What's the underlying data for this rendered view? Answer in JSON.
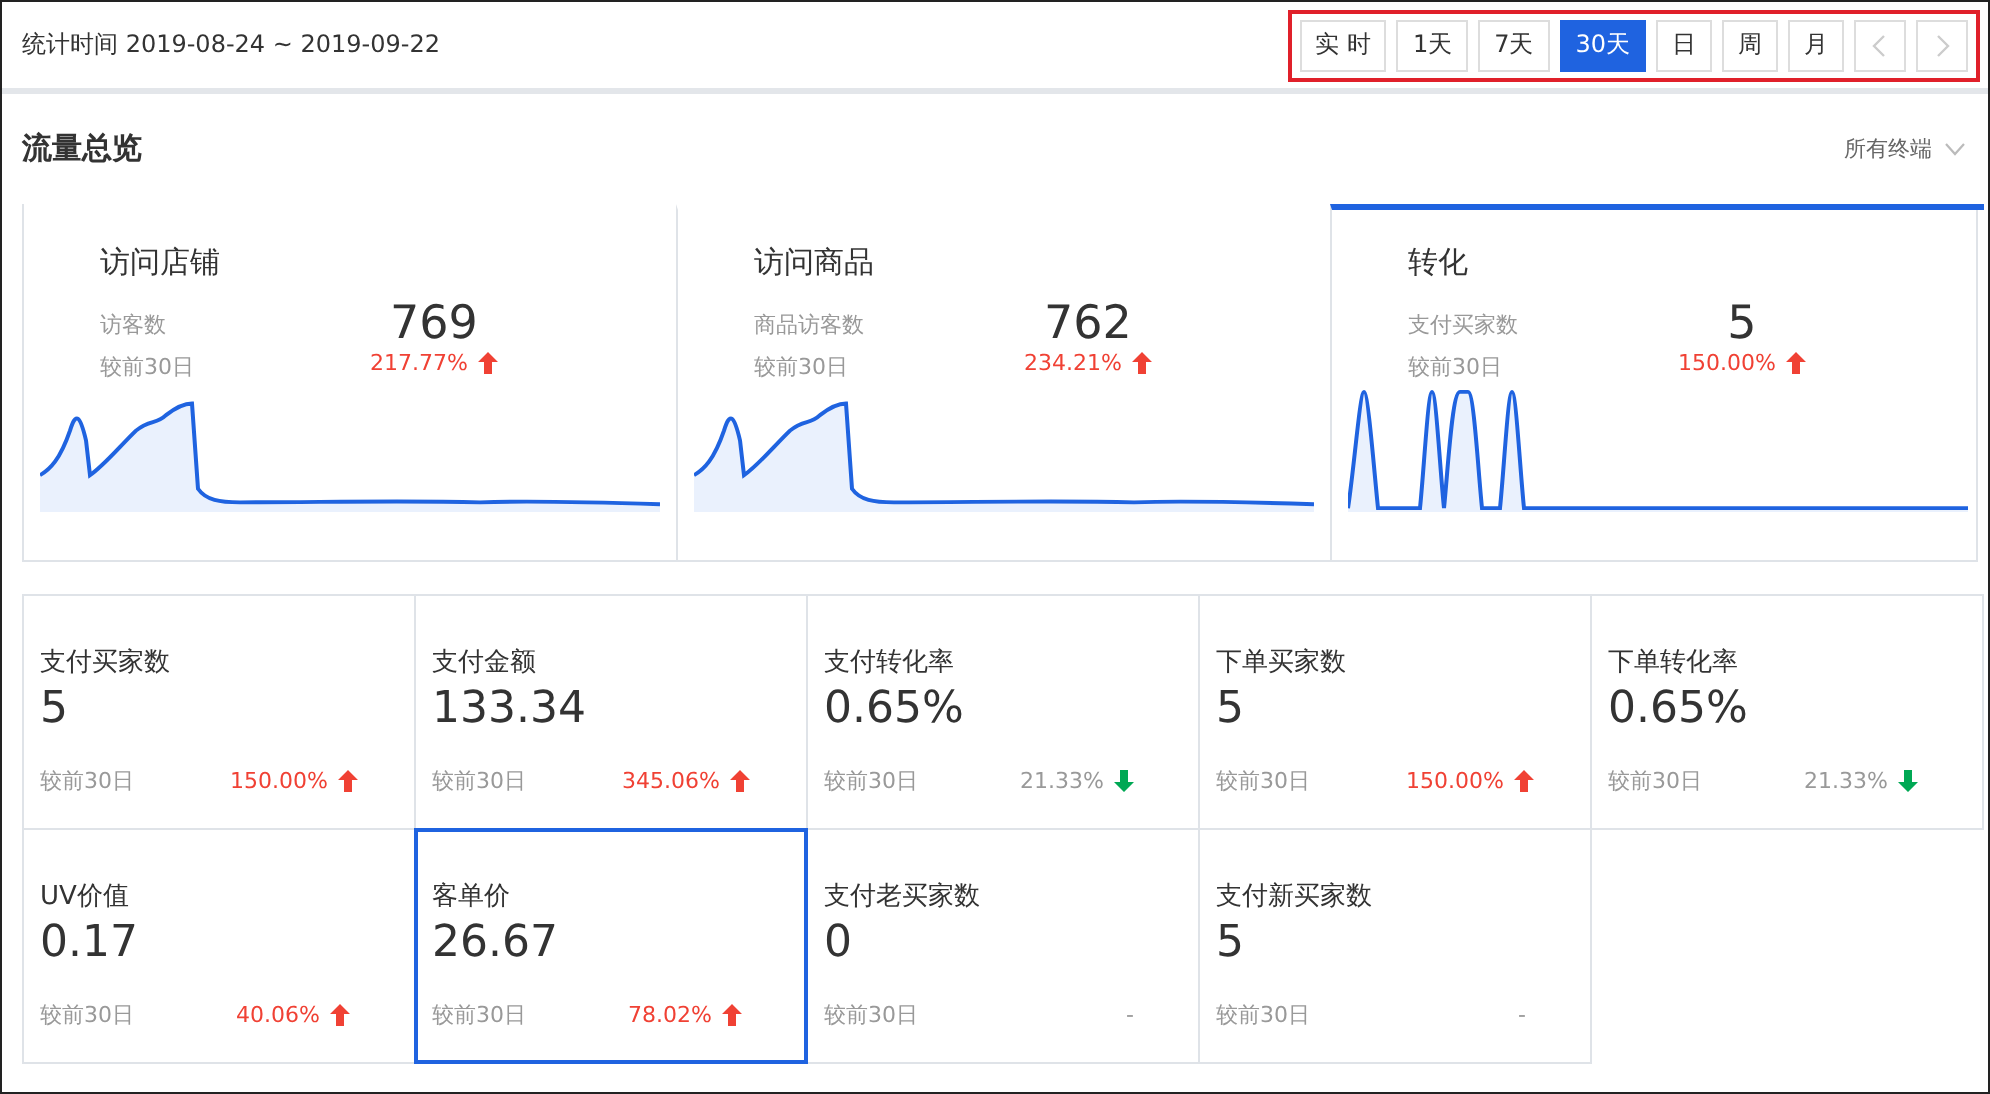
{
  "header": {
    "date_range": "统计时间 2019-08-24 ~ 2019-09-22",
    "periods": [
      {
        "label": "实 时",
        "selected": false
      },
      {
        "label": "1天",
        "selected": false
      },
      {
        "label": "7天",
        "selected": false
      },
      {
        "label": "30天",
        "selected": true
      },
      {
        "label": "日",
        "selected": false
      },
      {
        "label": "周",
        "selected": false
      },
      {
        "label": "月",
        "selected": false
      }
    ]
  },
  "section": {
    "title": "流量总览",
    "filter": "所有终端"
  },
  "summary_cards": [
    {
      "title": "访问店铺",
      "metric": "访客数",
      "value": "769",
      "compare": "较前30日",
      "change": "217.77%",
      "kind": "up",
      "selected": false
    },
    {
      "title": "访问商品",
      "metric": "商品访客数",
      "value": "762",
      "compare": "较前30日",
      "change": "234.21%",
      "kind": "up",
      "selected": false
    },
    {
      "title": "转化",
      "metric": "支付买家数",
      "value": "5",
      "compare": "较前30日",
      "change": "150.00%",
      "kind": "up",
      "selected": true
    }
  ],
  "metrics": [
    {
      "label": "支付买家数",
      "value": "5",
      "compare": "较前30日",
      "change": "150.00%",
      "kind": "up",
      "selected": false
    },
    {
      "label": "支付金额",
      "value": "133.34",
      "compare": "较前30日",
      "change": "345.06%",
      "kind": "up",
      "selected": false
    },
    {
      "label": "支付转化率",
      "value": "0.65%",
      "compare": "较前30日",
      "change": "21.33%",
      "kind": "down",
      "selected": false
    },
    {
      "label": "下单买家数",
      "value": "5",
      "compare": "较前30日",
      "change": "150.00%",
      "kind": "up",
      "selected": false
    },
    {
      "label": "下单转化率",
      "value": "0.65%",
      "compare": "较前30日",
      "change": "21.33%",
      "kind": "down",
      "selected": false
    },
    {
      "label": "UV价值",
      "value": "0.17",
      "compare": "较前30日",
      "change": "40.06%",
      "kind": "up",
      "selected": false
    },
    {
      "label": "客单价",
      "value": "26.67",
      "compare": "较前30日",
      "change": "78.02%",
      "kind": "up",
      "selected": true
    },
    {
      "label": "支付老买家数",
      "value": "0",
      "compare": "较前30日",
      "change": "-",
      "kind": "flat",
      "selected": false
    },
    {
      "label": "支付新买家数",
      "value": "5",
      "compare": "较前30日",
      "change": "-",
      "kind": "flat",
      "selected": false
    }
  ]
}
